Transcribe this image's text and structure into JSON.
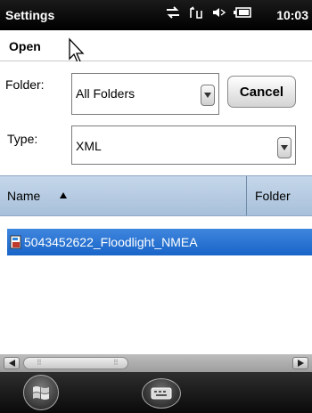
{
  "status_bar": {
    "title": "Settings",
    "time": "10:03",
    "icons": [
      "sync-icon",
      "signal-icon",
      "volume-icon",
      "battery-icon"
    ]
  },
  "menu": {
    "open_label": "Open"
  },
  "form": {
    "folder_label": "Folder:",
    "folder_value": "All Folders",
    "type_label": "Type:",
    "type_value": "XML",
    "cancel_label": "Cancel"
  },
  "list": {
    "columns": [
      "Name",
      "Folder"
    ],
    "items": [
      {
        "name": "5043452622_Floodlight_NMEA",
        "selected": true
      }
    ]
  },
  "colors": {
    "selection": "#1864c8",
    "header": "#b7cce3",
    "status_bar": "#000000"
  }
}
